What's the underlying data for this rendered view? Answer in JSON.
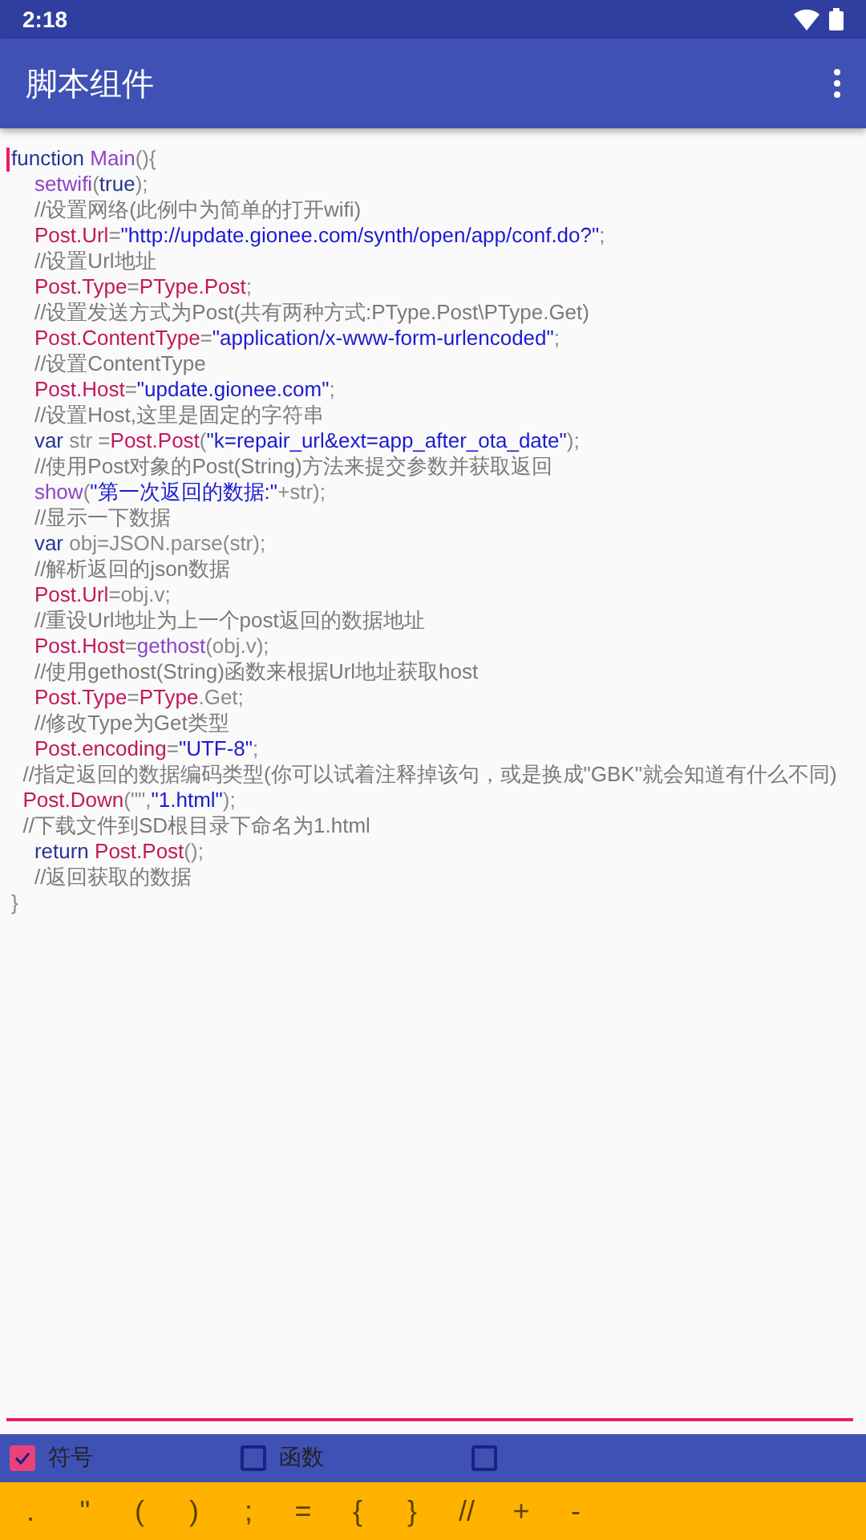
{
  "status_bar": {
    "time": "2:18"
  },
  "toolbar": {
    "title": "脚本组件"
  },
  "editor": {
    "lines": [
      [
        {
          "kind": "kw",
          "text": "function "
        },
        {
          "kind": "fn",
          "text": "Main"
        },
        {
          "kind": "plain",
          "text": "(){"
        }
      ],
      [
        {
          "kind": "fn",
          "text": "    setwifi"
        },
        {
          "kind": "plain",
          "text": "("
        },
        {
          "kind": "kw",
          "text": "true"
        },
        {
          "kind": "plain",
          "text": ");"
        }
      ],
      [
        {
          "kind": "cm",
          "text": "    //设置网络(此例中为简单的打开wifi)"
        }
      ],
      [
        {
          "kind": "obj",
          "text": "    Post.Url"
        },
        {
          "kind": "plain",
          "text": "="
        },
        {
          "kind": "str",
          "text": "\"http://update.gionee.com/synth/open/app/conf.do?\""
        },
        {
          "kind": "plain",
          "text": ";"
        }
      ],
      [
        {
          "kind": "cm",
          "text": "    //设置Url地址"
        }
      ],
      [
        {
          "kind": "obj",
          "text": "    Post.Type"
        },
        {
          "kind": "plain",
          "text": "="
        },
        {
          "kind": "obj",
          "text": "PType.Post"
        },
        {
          "kind": "plain",
          "text": ";"
        }
      ],
      [
        {
          "kind": "cm",
          "text": "    //设置发送方式为Post(共有两种方式:PType.Post\\PType.Get)"
        }
      ],
      [
        {
          "kind": "obj",
          "text": "    Post.ContentType"
        },
        {
          "kind": "plain",
          "text": "="
        },
        {
          "kind": "str",
          "text": "\"application/x-www-form-urlencoded\""
        },
        {
          "kind": "plain",
          "text": ";"
        }
      ],
      [
        {
          "kind": "cm",
          "text": "    //设置ContentType"
        }
      ],
      [
        {
          "kind": "obj",
          "text": "    Post.Host"
        },
        {
          "kind": "plain",
          "text": "="
        },
        {
          "kind": "str",
          "text": "\"update.gionee.com\""
        },
        {
          "kind": "plain",
          "text": ";"
        }
      ],
      [
        {
          "kind": "cm",
          "text": "    //设置Host,这里是固定的字符串"
        }
      ],
      [
        {
          "kind": "kw",
          "text": "    var"
        },
        {
          "kind": "plain",
          "text": " str ="
        },
        {
          "kind": "obj",
          "text": "Post.Post"
        },
        {
          "kind": "plain",
          "text": "("
        },
        {
          "kind": "str",
          "text": "\"k=repair_url&ext=app_after_ota_date\""
        },
        {
          "kind": "plain",
          "text": ");"
        }
      ],
      [
        {
          "kind": "cm",
          "text": "    //使用Post对象的Post(String)方法来提交参数并获取返回"
        }
      ],
      [
        {
          "kind": "fn",
          "text": "    show"
        },
        {
          "kind": "plain",
          "text": "("
        },
        {
          "kind": "str",
          "text": "\"第一次返回的数据:\""
        },
        {
          "kind": "plain",
          "text": "+str);"
        }
      ],
      [
        {
          "kind": "cm",
          "text": "    //显示一下数据"
        }
      ],
      [
        {
          "kind": "kw",
          "text": "    var"
        },
        {
          "kind": "plain",
          "text": " obj=JSON.parse(str);"
        }
      ],
      [
        {
          "kind": "cm",
          "text": "    //解析返回的json数据"
        }
      ],
      [
        {
          "kind": "obj",
          "text": "    Post.Url"
        },
        {
          "kind": "plain",
          "text": "=obj.v;"
        }
      ],
      [
        {
          "kind": "cm",
          "text": "    //重设Url地址为上一个post返回的数据地址"
        }
      ],
      [
        {
          "kind": "obj",
          "text": "    Post.Host"
        },
        {
          "kind": "plain",
          "text": "="
        },
        {
          "kind": "fn",
          "text": "gethost"
        },
        {
          "kind": "plain",
          "text": "(obj.v);"
        }
      ],
      [
        {
          "kind": "cm",
          "text": "    //使用gethost(String)函数来根据Url地址获取host"
        }
      ],
      [
        {
          "kind": "obj",
          "text": "    Post.Type"
        },
        {
          "kind": "plain",
          "text": "="
        },
        {
          "kind": "obj",
          "text": "PType"
        },
        {
          "kind": "plain",
          "text": ".Get;"
        }
      ],
      [
        {
          "kind": "cm",
          "text": "    //修改Type为Get类型"
        }
      ],
      [
        {
          "kind": "obj",
          "text": "    Post.encoding"
        },
        {
          "kind": "plain",
          "text": "="
        },
        {
          "kind": "str",
          "text": "\"UTF-8\""
        },
        {
          "kind": "plain",
          "text": ";"
        }
      ],
      [
        {
          "kind": "cm",
          "text": "  //指定返回的数据编码类型(你可以试着注释掉该句，或是换成\"GBK\"就会知道有什么不同)"
        }
      ],
      [
        {
          "kind": "obj",
          "text": "  Post.Down"
        },
        {
          "kind": "plain",
          "text": "(\"\","
        },
        {
          "kind": "str",
          "text": "\"1.html\""
        },
        {
          "kind": "plain",
          "text": ");"
        }
      ],
      [
        {
          "kind": "cm",
          "text": "  //下载文件到SD根目录下命名为1.html"
        }
      ],
      [
        {
          "kind": "kw",
          "text": "    return "
        },
        {
          "kind": "obj",
          "text": "Post.Post"
        },
        {
          "kind": "plain",
          "text": "();"
        }
      ],
      [
        {
          "kind": "cm",
          "text": "    //返回获取的数据"
        }
      ],
      [
        {
          "kind": "plain",
          "text": "}"
        }
      ]
    ]
  },
  "options": [
    {
      "label": "符号",
      "checked": true
    },
    {
      "label": "函数",
      "checked": false
    },
    {
      "checked": false
    }
  ],
  "symbol_keys": [
    ".",
    "\"",
    "(",
    ")",
    ";",
    "=",
    "{",
    "}",
    "//",
    "+",
    "-"
  ]
}
